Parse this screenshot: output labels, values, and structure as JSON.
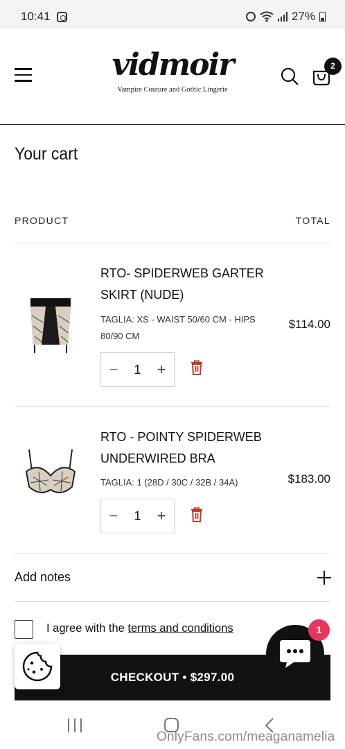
{
  "status_bar": {
    "time": "10:41",
    "battery": "27%"
  },
  "header": {
    "logo_text": "vidmoir",
    "tagline": "Vampire Couture and Gothic Lingerie",
    "cart_count": "2"
  },
  "cart": {
    "title": "Your cart",
    "col_product": "PRODUCT",
    "col_total": "TOTAL",
    "items": [
      {
        "title": "RTO- SPIDERWEB GARTER SKIRT (NUDE)",
        "variant": "TAGLIA: XS - WAIST 50/60 CM - HIPS 80/90 CM",
        "price": "$114.00",
        "quantity": "1"
      },
      {
        "title": "RTO - POINTY SPIDERWEB UNDERWIRED BRA",
        "variant": "TAGLIA: 1 (28D / 30C / 32B / 34A)",
        "price": "$183.00",
        "quantity": "1"
      }
    ],
    "qty_minus": "−",
    "qty_plus": "+",
    "notes_label": "Add notes",
    "agree_prefix": "I agree with the ",
    "agree_link": "terms and conditions",
    "checkout_label": "CHECKOUT • $297.00"
  },
  "chat": {
    "badge": "1"
  },
  "watermark": "OnlyFans.com/meaganamelia",
  "colors": {
    "accent_dark": "#121212",
    "trash_red": "#c0392b",
    "badge_pink": "#e8365d"
  }
}
